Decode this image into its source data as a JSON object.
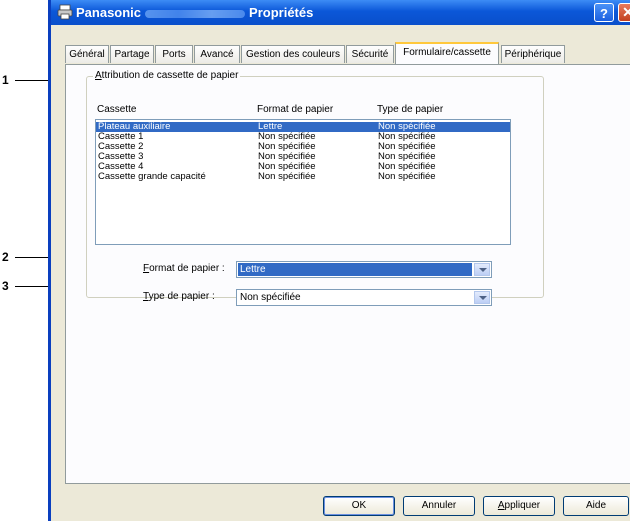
{
  "window": {
    "title_brand": "Panasonic",
    "title_suffix": "Propriétés",
    "help_label": "?",
    "close_label": "✕"
  },
  "tabs": [
    {
      "label": "Général"
    },
    {
      "label": "Partage"
    },
    {
      "label": "Ports"
    },
    {
      "label": "Avancé"
    },
    {
      "label": "Gestion des couleurs"
    },
    {
      "label": "Sécurité"
    },
    {
      "label": "Formulaire/cassette",
      "active": true
    },
    {
      "label": "Périphérique"
    }
  ],
  "group": {
    "title_accel": "A",
    "title_rest": "ttribution de cassette de papier",
    "columns": [
      "Cassette",
      "Format de papier",
      "Type de papier"
    ],
    "rows": [
      {
        "cassette": "Plateau auxiliaire",
        "format": "Lettre",
        "type": "Non spécifiée",
        "selected": true
      },
      {
        "cassette": "Cassette 1",
        "format": "Non spécifiée",
        "type": "Non spécifiée"
      },
      {
        "cassette": "Cassette 2",
        "format": "Non spécifiée",
        "type": "Non spécifiée"
      },
      {
        "cassette": "Cassette 3",
        "format": "Non spécifiée",
        "type": "Non spécifiée"
      },
      {
        "cassette": "Cassette 4",
        "format": "Non spécifiée",
        "type": "Non spécifiée"
      },
      {
        "cassette": "Cassette grande capacité",
        "format": "Non spécifiée",
        "type": "Non spécifiée"
      }
    ]
  },
  "format_field": {
    "label_accel": "F",
    "label_rest": "ormat de papier :",
    "value": "Lettre"
  },
  "type_field": {
    "label_accel": "T",
    "label_rest": "ype de papier :",
    "value": "Non spécifiée"
  },
  "buttons": {
    "ok": "OK",
    "cancel": "Annuler",
    "apply_accel": "A",
    "apply_rest": "ppliquer",
    "help": "Aide"
  },
  "callouts": [
    "1",
    "2",
    "3"
  ]
}
